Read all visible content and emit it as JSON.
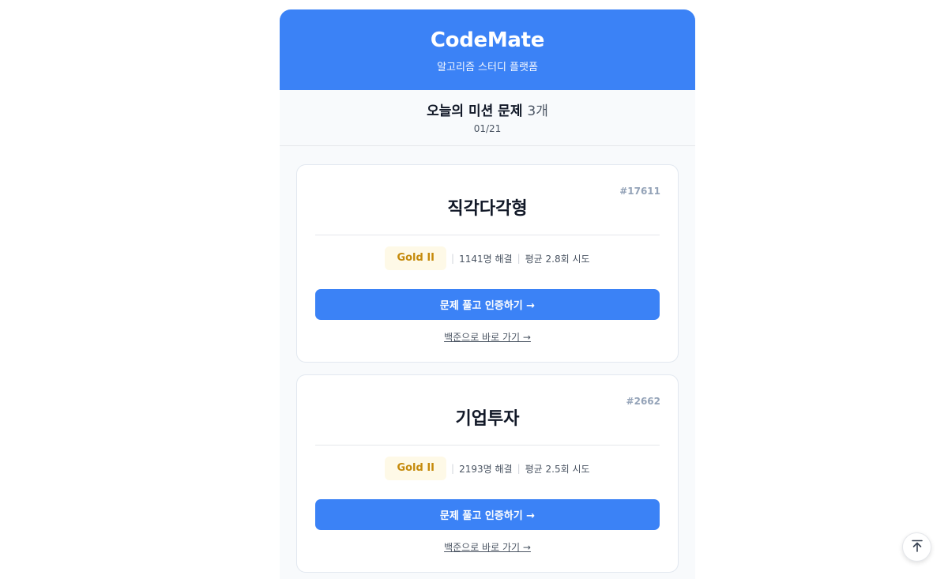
{
  "header": {
    "brand": "CodeMate",
    "tagline": "알고리즘 스터디 플랫폼"
  },
  "mission": {
    "title": "오늘의 미션 문제",
    "count": "3개",
    "date": "01/21"
  },
  "problems": [
    {
      "id": "#17611",
      "title": "직각다각형",
      "tier": "Gold II",
      "solved": "1141명 해결",
      "avg_attempts": "평균 2.8회 시도",
      "solve_label": "문제 풀고 인증하기 →",
      "link_label": "백준으로 바로 가기 →"
    },
    {
      "id": "#2662",
      "title": "기업투자",
      "tier": "Gold II",
      "solved": "2193명 해결",
      "avg_attempts": "평균 2.5회 시도",
      "solve_label": "문제 풀고 인증하기 →",
      "link_label": "백준으로 바로 가기 →"
    }
  ],
  "icons": {
    "scroll_top": "arrow-up-to-line-icon"
  },
  "colors": {
    "primary": "#3b82f6",
    "tier_gold_text": "#c58a0b",
    "tier_gold_bg": "#fef9e7"
  }
}
